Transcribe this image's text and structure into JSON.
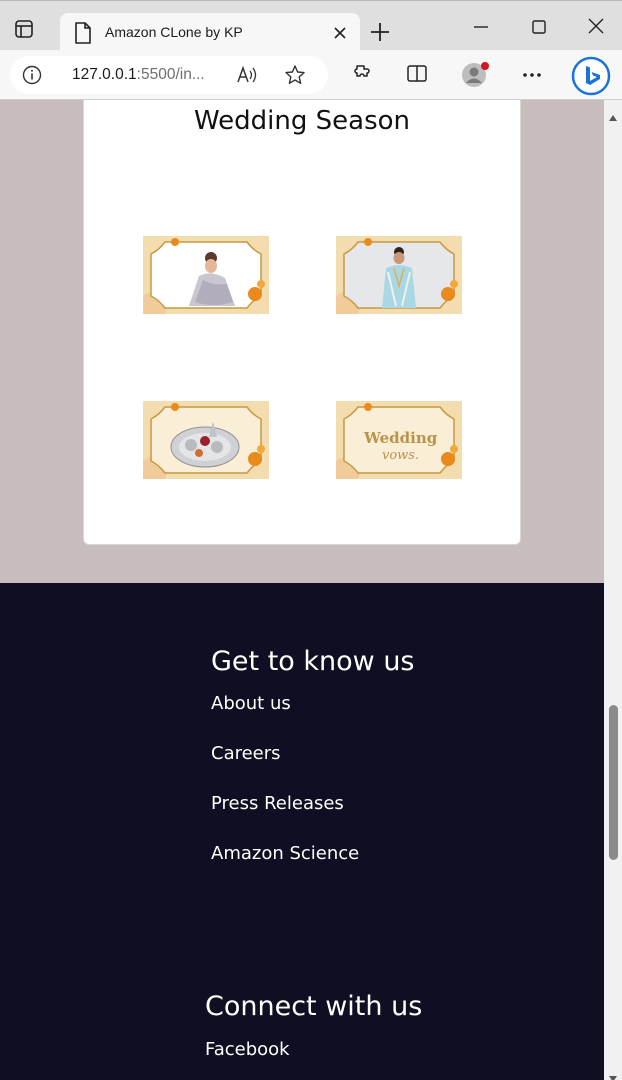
{
  "browser": {
    "tab_title": "Amazon CLone by KP",
    "url_host": "127.0.0.1",
    "url_rest": ":5500/in..."
  },
  "card": {
    "title": "Wedding Season",
    "tiles": [
      {
        "name": "woman-saree-image"
      },
      {
        "name": "man-sherwani-image"
      },
      {
        "name": "silver-pooja-thali-image"
      },
      {
        "name": "wedding-vows-image",
        "text": "Wedding",
        "text2": "vows."
      }
    ]
  },
  "footer": {
    "section1_title": "Get to know us",
    "section1_links": [
      "About us",
      "Careers",
      "Press Releases",
      "Amazon Science"
    ],
    "section2_title": "Connect with us",
    "section2_links": [
      "Facebook"
    ]
  },
  "colors": {
    "page_bg": "#c7bdbd",
    "footer_bg": "#0e0f22",
    "card_bg": "#ffffff",
    "tile_bg": "#f3dcae",
    "accent_orange": "#e98a1c"
  }
}
